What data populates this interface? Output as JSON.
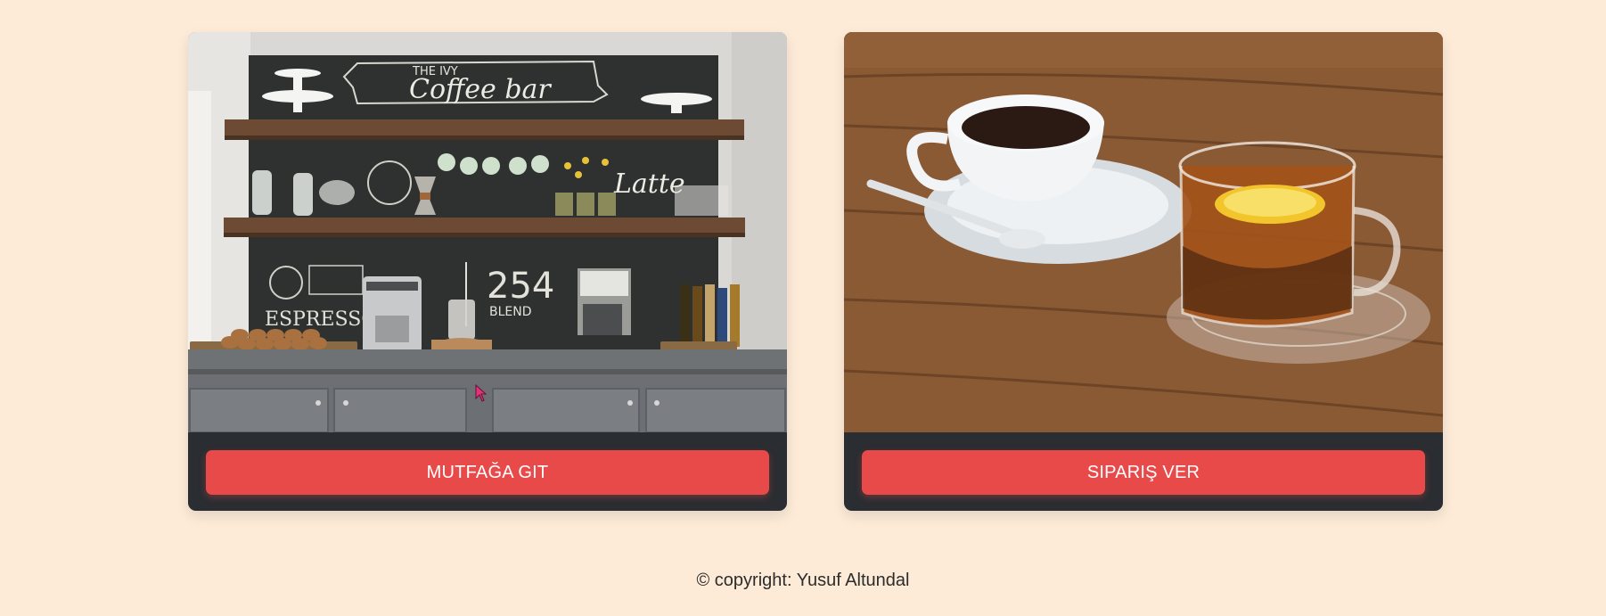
{
  "colors": {
    "page_background": "#fdebd8",
    "card_footer": "#2a2d31",
    "button": "#e84a4a",
    "button_text": "#ffffff"
  },
  "cards": [
    {
      "image": "coffee-bar-photo",
      "chalkboard_text": [
        "THE IVY",
        "Coffee bar",
        "ESPRESSO",
        "254",
        "BLEND",
        "Latte"
      ],
      "button_label": "MUTFAĞA GIT"
    },
    {
      "image": "coffee-and-tea-photo",
      "button_label": "SIPARIŞ VER"
    }
  ],
  "footer": {
    "copyright": "© copyright: Yusuf Altundal"
  }
}
